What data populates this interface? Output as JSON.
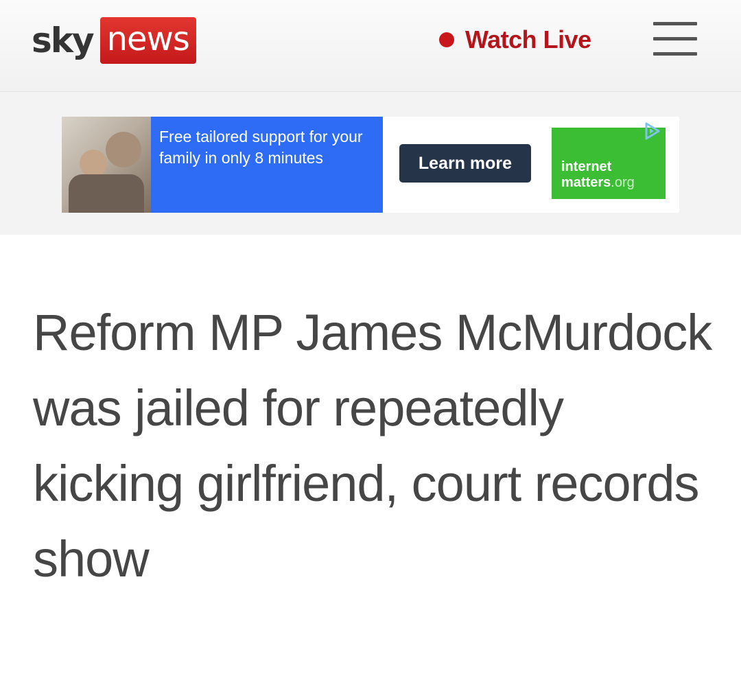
{
  "header": {
    "logo_sky": "sky",
    "logo_news": "news",
    "watch_live_label": "Watch Live"
  },
  "ad": {
    "copy": "Free tailored support for your family in only 8 minutes",
    "cta_label": "Learn more",
    "brand_line1": "internet",
    "brand_line2": "matters",
    "brand_suffix": ".org"
  },
  "article": {
    "headline": "Reform MP James McMurdock was jailed for repeatedly kicking girlfriend, court records show"
  },
  "colors": {
    "brand_red": "#c4191b",
    "live_red": "#b5141a",
    "ad_blue": "#2f6cf5",
    "ad_button": "#26344a",
    "ad_green": "#3bbe34",
    "headline_text": "#464646"
  },
  "icons": [
    "live-dot-icon",
    "menu-icon",
    "ad-choices-icon"
  ]
}
